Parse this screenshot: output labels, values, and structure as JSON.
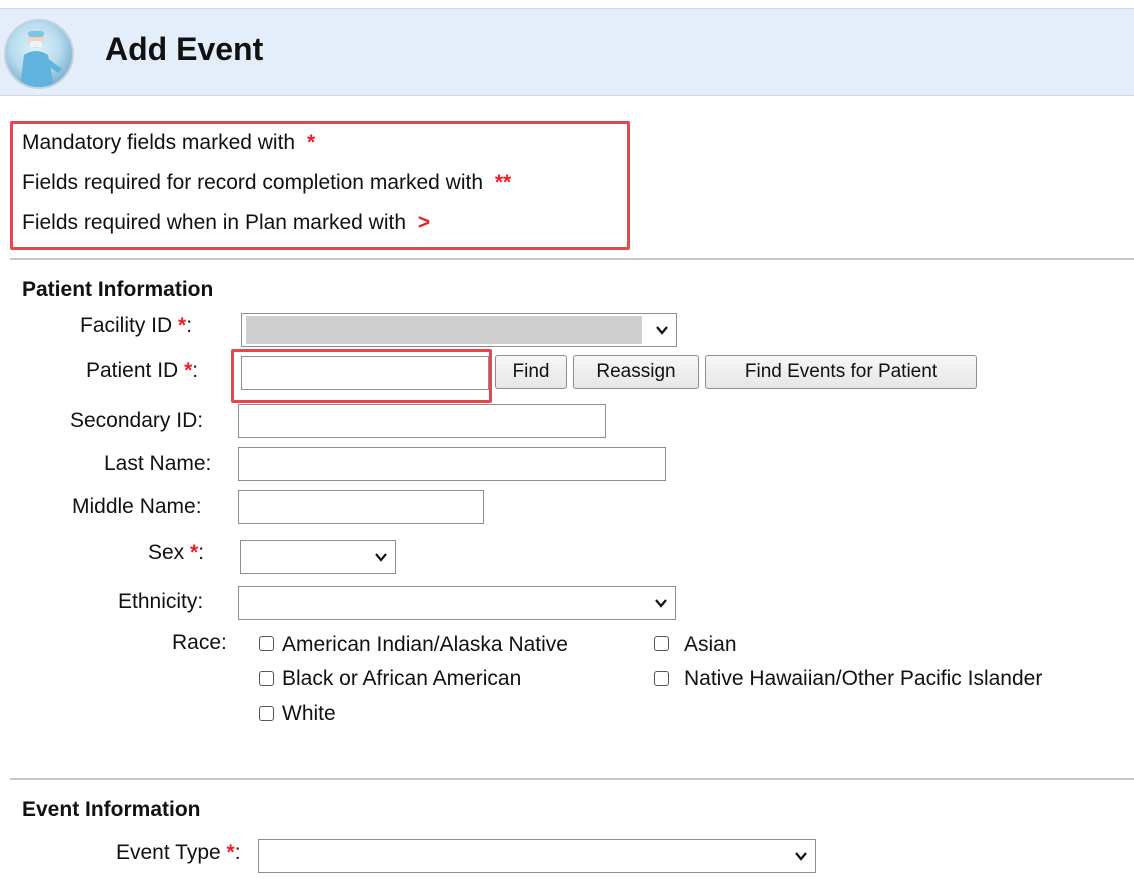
{
  "header": {
    "title": "Add Event",
    "icon": "surgeon-avatar-icon"
  },
  "legend": {
    "mandatory_text": "Mandatory fields marked with",
    "mandatory_mark": "*",
    "completion_text": "Fields required for record completion marked with",
    "completion_mark": "**",
    "plan_text": "Fields required when in Plan marked with",
    "plan_mark": ">"
  },
  "patient_section": {
    "title": "Patient Information",
    "facility_label": "Facility ID",
    "patient_id_label": "Patient ID",
    "secondary_id_label": "Secondary ID",
    "last_name_label": "Last Name",
    "middle_name_label": "Middle Name",
    "sex_label": "Sex",
    "ethnicity_label": "Ethnicity",
    "race_label": "Race:",
    "colon": ":",
    "required_mark": "*",
    "find_button": "Find",
    "reassign_button": "Reassign",
    "find_events_button": "Find Events for Patient",
    "race_options": [
      "American Indian/Alaska Native",
      "Asian",
      "Black or African American",
      "Native Hawaiian/Other Pacific Islander",
      "White"
    ]
  },
  "event_section": {
    "title": "Event Information",
    "event_type_label": "Event Type"
  },
  "colors": {
    "required": "#e8202a",
    "highlight": "#e6474d",
    "header_bg": "#e3eefa"
  }
}
